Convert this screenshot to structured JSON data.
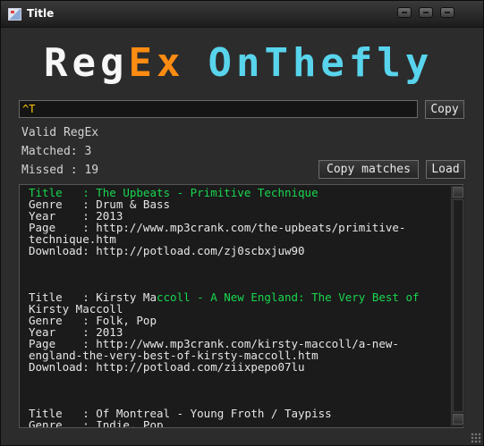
{
  "window": {
    "title": "Title",
    "minimize_icon": "minimize-icon",
    "maximize_icon": "maximize-icon",
    "close_icon": "close-icon"
  },
  "logo": {
    "part1": "Reg",
    "part2": "Ex",
    "part3": "OnThefly",
    "colors": {
      "part1": "#f7f7f7",
      "part2": "#ff8c12",
      "part3": "#58d4ec"
    }
  },
  "regex": {
    "value": "^T",
    "copy_label": "Copy"
  },
  "status": {
    "valid": "Valid RegEx",
    "matched": "Matched: 3",
    "missed": "Missed : 19"
  },
  "actions": {
    "copy_matches_label": "Copy matches",
    "load_label": "Load"
  },
  "results": {
    "entries": [
      {
        "match": "Title   : The Upbeats - Primitive Technique",
        "rest": "\nGenre   : Drum & Bass\nYear    : 2013\nPage    : http://www.mp3crank.com/the-upbeats/primitive-\ntechnique.htm\nDownload: http://potload.com/zj0scbxjuw90\n\n\n\n"
      },
      {
        "plain_prefix": "Title   : Kirsty Ma",
        "match": "ccoll - A New England: The Very Best of",
        "rest": "\nKirsty Maccoll\nGenre   : Folk, Pop\nYear    : 2013\nPage    : http://www.mp3crank.com/kirsty-maccoll/a-new-\nengland-the-very-best-of-kirsty-maccoll.htm\nDownload: http://potload.com/ziixpepo07lu\n\n\n\n"
      },
      {
        "text": "Title   : Of Montreal - Young Froth / Taypiss\nGenre   : Indie, Pop"
      }
    ],
    "highlight_color": "#19d64f"
  }
}
